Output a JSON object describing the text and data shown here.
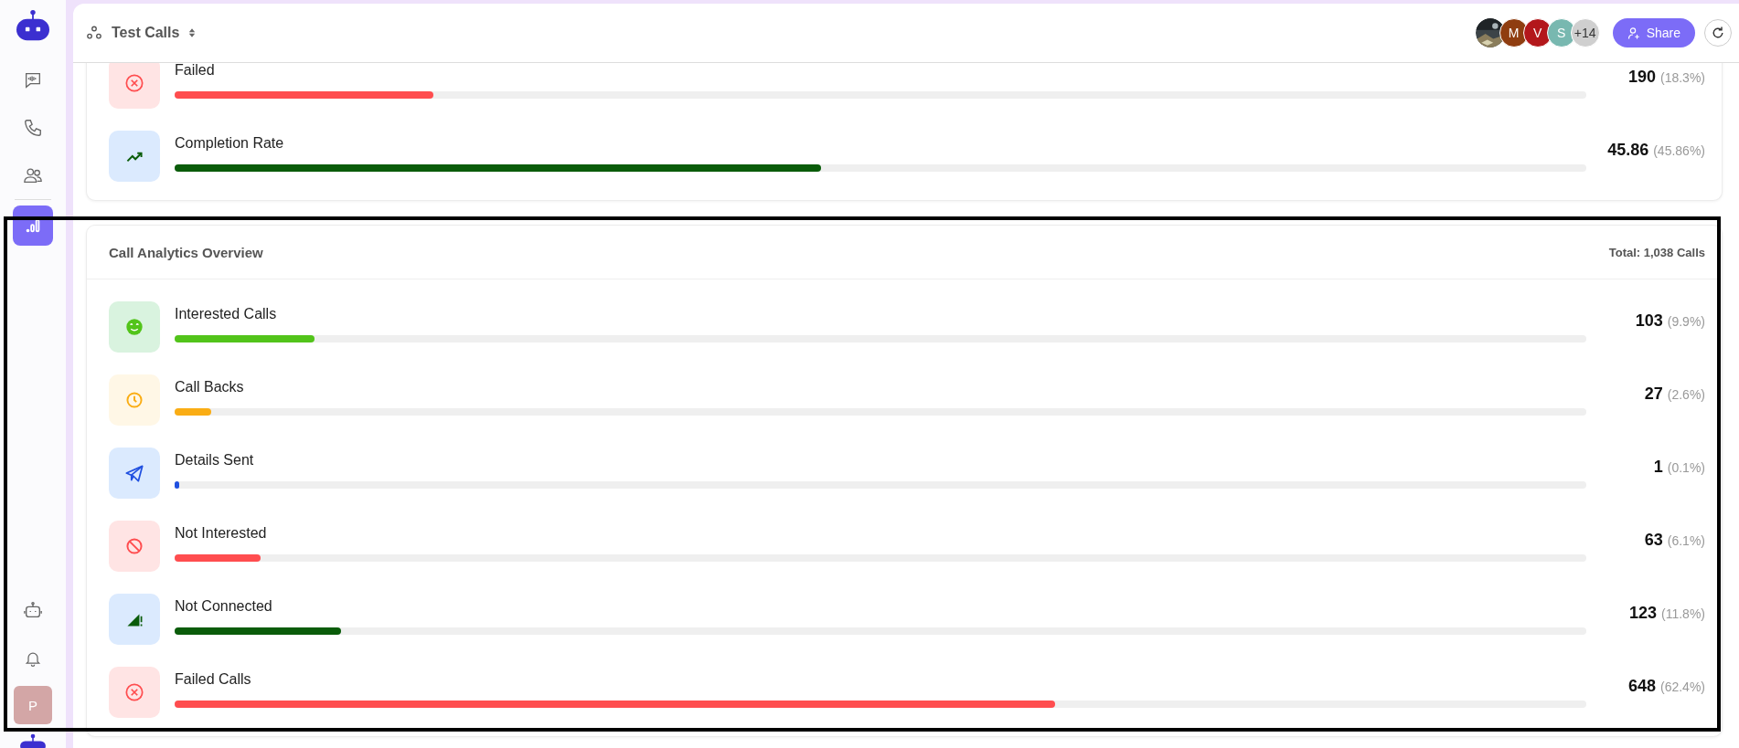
{
  "sidebar": {
    "items": [
      {
        "kind": "chat",
        "selected": false
      },
      {
        "kind": "phone",
        "selected": false
      },
      {
        "kind": "users",
        "selected": false
      },
      {
        "kind": "analytics",
        "selected": true
      }
    ],
    "bottom_items": [
      {
        "kind": "robot"
      },
      {
        "kind": "bell"
      }
    ],
    "user_avatar": "P"
  },
  "header": {
    "title": "Test Calls",
    "avatars": [
      {
        "kind": "picture"
      },
      {
        "kind": "letter",
        "text": "M",
        "color": "#8f3d10"
      },
      {
        "kind": "letter",
        "text": "V",
        "color": "#b3171b"
      },
      {
        "kind": "letter",
        "text": "S",
        "color": "#78b8b0"
      },
      {
        "kind": "letter",
        "text": "+14",
        "color": "#cfcfcf"
      }
    ],
    "share_button": "Share"
  },
  "summary_card": {
    "rows": [
      {
        "kind": "failed",
        "label": "Failed",
        "level": 0.183,
        "color": "#ff4d4f",
        "count": "190",
        "percent": "(18.3%)"
      },
      {
        "kind": "trend",
        "label": "Completion Rate",
        "level": 0.458,
        "color": "#0a5c0a",
        "count": "45.86",
        "percent": "(45.86%)"
      }
    ]
  },
  "analytics_card": {
    "title": "Call Analytics Overview",
    "total": "Total: 1,038 Calls",
    "rows": [
      {
        "kind": "smile",
        "label": "Interested Calls",
        "level": 0.099,
        "color": "#52c41a",
        "count": "103",
        "percent": "(9.9%)"
      },
      {
        "kind": "clock",
        "label": "Call Backs",
        "level": 0.026,
        "color": "#faad14",
        "count": "27",
        "percent": "(2.6%)"
      },
      {
        "kind": "send",
        "label": "Details Sent",
        "level": 0.001,
        "color": "#2050e0",
        "count": "1",
        "percent": "(0.1%)"
      },
      {
        "kind": "ban",
        "label": "Not Interested",
        "level": 0.061,
        "color": "#ff4d4f",
        "count": "63",
        "percent": "(6.1%)"
      },
      {
        "kind": "signal",
        "label": "Not Connected",
        "level": 0.118,
        "color": "#0a5c0a",
        "count": "123",
        "percent": "(11.8%)"
      },
      {
        "kind": "failed",
        "label": "Failed Calls",
        "level": 0.624,
        "color": "#ff4d4f",
        "count": "648",
        "percent": "(62.4%)"
      }
    ]
  }
}
